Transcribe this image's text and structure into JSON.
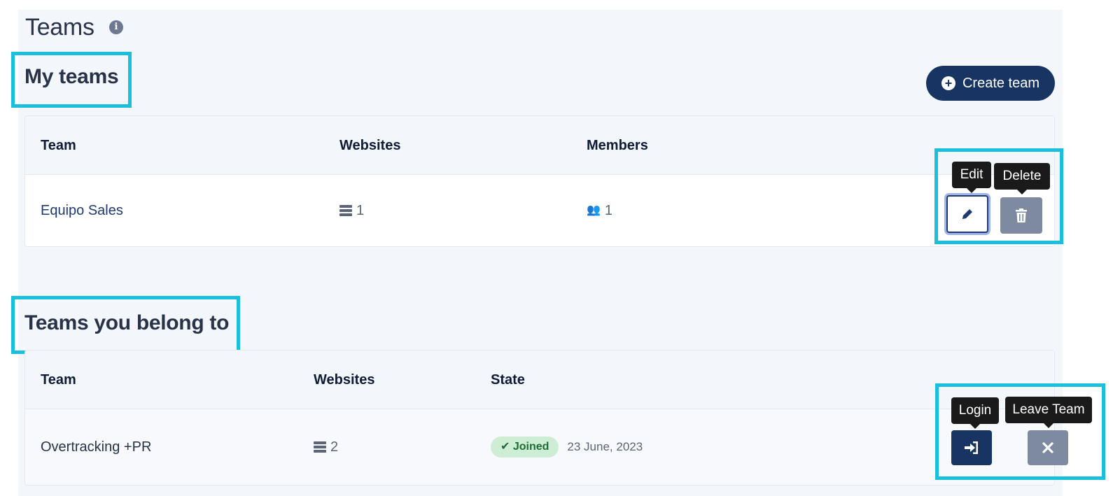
{
  "page": {
    "title": "Teams",
    "info_icon": "info-icon"
  },
  "my_teams": {
    "title": "My teams",
    "create_button": "Create team",
    "columns": [
      "Team",
      "Websites",
      "Members"
    ],
    "rows": [
      {
        "team": "Equipo Sales",
        "websites": "1",
        "members": "1"
      }
    ],
    "tooltips": {
      "edit": "Edit",
      "delete": "Delete"
    }
  },
  "belong_teams": {
    "title": "Teams you belong to",
    "columns": [
      "Team",
      "Websites",
      "State"
    ],
    "rows": [
      {
        "team": "Overtracking +PR",
        "websites": "2",
        "state": "Joined",
        "date": "23 June, 2023"
      }
    ],
    "tooltips": {
      "login": "Login",
      "leave": "Leave Team"
    }
  },
  "colors": {
    "primary": "#173463",
    "highlight": "#19bfdc",
    "panel_bg": "#f3f7fc",
    "delete_gray": "#7d8aa0",
    "joined_bg": "#cdeed5"
  }
}
